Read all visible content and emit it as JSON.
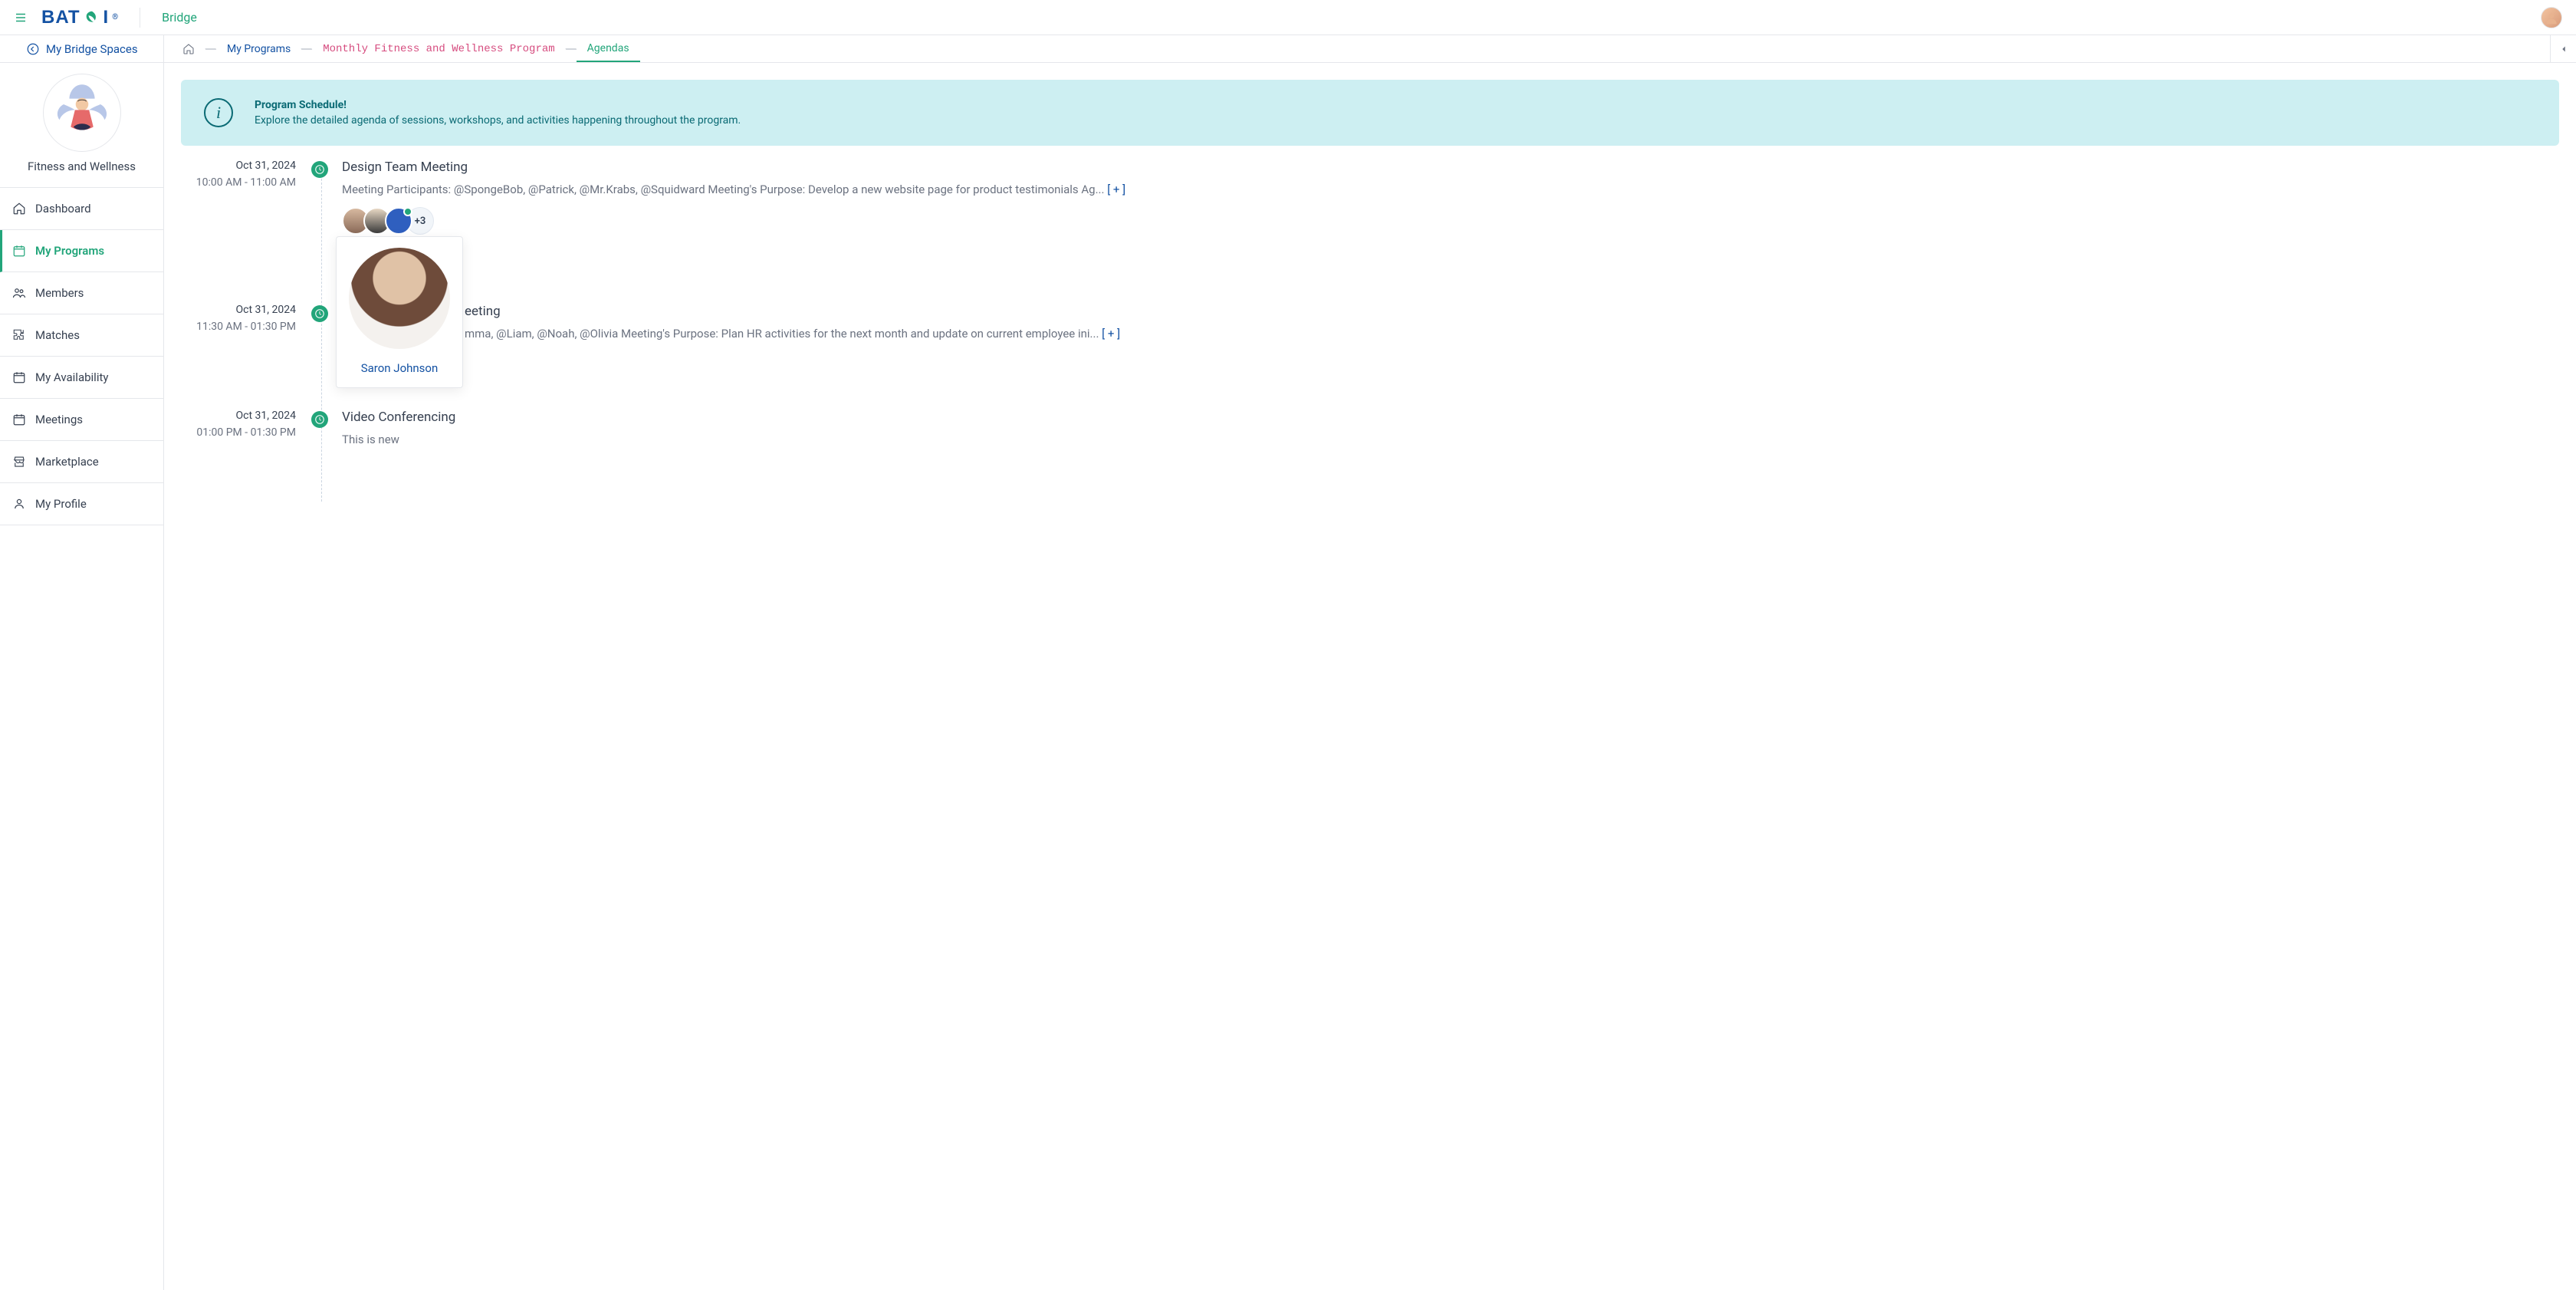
{
  "colors": {
    "accent": "#22A57A",
    "link": "#1452A3",
    "mono": "#D64C7F",
    "alert_bg": "#CDEFF2"
  },
  "header": {
    "logo_text": "BAT",
    "logo_suffix": "I",
    "product_name": "Bridge"
  },
  "breadcrumb": {
    "back_label": "My Bridge Spaces",
    "items": [
      {
        "kind": "home"
      },
      {
        "label": "My Programs",
        "style": "link"
      },
      {
        "label": "Monthly Fitness and Wellness Program",
        "style": "mono"
      },
      {
        "label": "Agendas",
        "style": "active"
      }
    ]
  },
  "space": {
    "name": "Fitness and Wellness"
  },
  "nav": [
    {
      "icon": "home",
      "label": "Dashboard",
      "active": false
    },
    {
      "icon": "calendar",
      "label": "My Programs",
      "active": true
    },
    {
      "icon": "users",
      "label": "Members",
      "active": false
    },
    {
      "icon": "puzzle",
      "label": "Matches",
      "active": false
    },
    {
      "icon": "calendar",
      "label": "My Availability",
      "active": false
    },
    {
      "icon": "calendar",
      "label": "Meetings",
      "active": false
    },
    {
      "icon": "store",
      "label": "Marketplace",
      "active": false
    },
    {
      "icon": "user",
      "label": "My Profile",
      "active": false
    }
  ],
  "alert": {
    "title": "Program Schedule!",
    "desc": "Explore the detailed agenda of sessions, workshops, and activities happening throughout the program."
  },
  "agenda": [
    {
      "date": "Oct 31, 2024",
      "time": "10:00 AM - 11:00 AM",
      "title": "Design Team Meeting",
      "desc": "Meeting Participants: @SpongeBob, @Patrick, @Mr.Krabs, @Squidward Meeting's Purpose: Develop a new website page for product testimonials Ag...",
      "expand": "[ + ]",
      "participants_more": "+3",
      "hover_person": "Saron Johnson"
    },
    {
      "date": "Oct 31, 2024",
      "time": "11:30 AM - 01:30 PM",
      "title": "eeting",
      "desc": "mma, @Liam, @Noah, @Olivia Meeting's Purpose: Plan HR activities for the next month and update on current employee ini...",
      "expand": "[ + ]"
    },
    {
      "date": "Oct 31, 2024",
      "time": "01:00 PM - 01:30 PM",
      "title": "Video Conferencing",
      "desc": "This is new"
    }
  ]
}
